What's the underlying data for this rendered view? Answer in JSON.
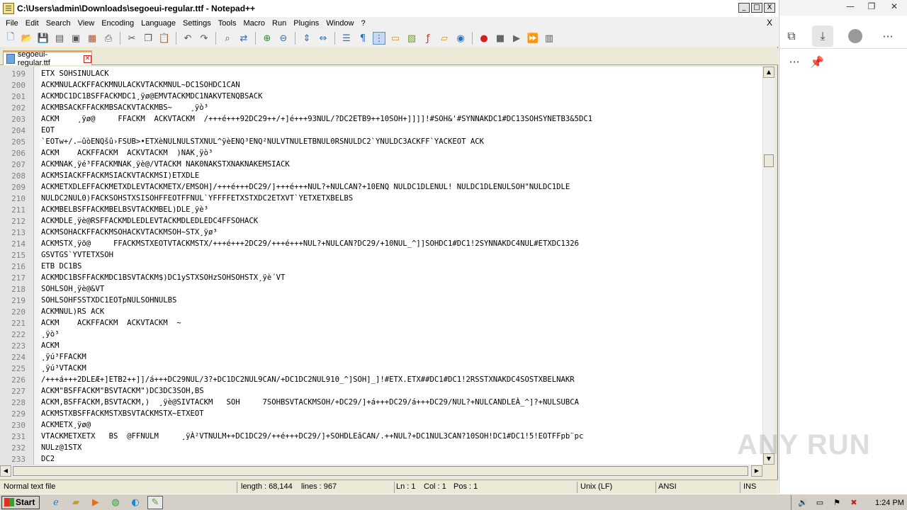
{
  "window": {
    "title": "C:\\Users\\admin\\Downloads\\segoeui-regular.ttf - Notepad++",
    "minimize": "_",
    "maximize": "□",
    "close": "X"
  },
  "menu": {
    "items": [
      "File",
      "Edit",
      "Search",
      "View",
      "Encoding",
      "Language",
      "Settings",
      "Tools",
      "Macro",
      "Run",
      "Plugins",
      "Window",
      "?"
    ],
    "close_doc": "X"
  },
  "toolbar": {
    "icons": [
      "new-file-icon",
      "open-file-icon",
      "save-icon",
      "save-all-icon",
      "close-icon",
      "close-all-icon",
      "print-icon",
      "cut-icon",
      "copy-icon",
      "paste-icon",
      "undo-icon",
      "redo-icon",
      "find-icon",
      "replace-icon",
      "zoom-in-icon",
      "zoom-out-icon",
      "sync-vertical-icon",
      "sync-horizontal-icon",
      "word-wrap-icon",
      "show-all-chars-icon",
      "indent-guide-icon",
      "udl-icon",
      "doc-map-icon",
      "function-list-icon",
      "folder-workspace-icon",
      "monitoring-icon",
      "record-macro-icon",
      "stop-macro-icon",
      "play-macro-icon",
      "run-macro-multiple-icon",
      "save-macro-icon"
    ]
  },
  "tab": {
    "label": "segoeui-regular.ttf",
    "close": "✕"
  },
  "editor": {
    "lines": [
      {
        "n": "199",
        "text": "ETX SOHSINULACK"
      },
      {
        "n": "200",
        "text": "ACKMNULACKFFACKMNULACKVTACKMNUL~DC1SOHDC1CAN"
      },
      {
        "n": "201",
        "text": "ACKMDC1DC1BSFFACKMDC1¸ÿø@EMVTACKMDC1NAKVTENQBSACK"
      },
      {
        "n": "202",
        "text": "ACKMBSACKFFACKMBSACKVTACKMBS~    ¸ÿò³"
      },
      {
        "n": "203",
        "text": "ACKM    ¸ÿø@     FFACKM  ACKVTACKM  /+++é+++92DC29++/+]é+++93NUL/?DC2ETB9++10SOH+]]]]!#SOH&'#SYNNAKDC1#DC13SOHSYNETB3&5DC1"
      },
      {
        "n": "204",
        "text": "EOT"
      },
      {
        "n": "205",
        "text": "`EOTw+/.—ûòENQšû›FSUB>•ETXèNULNULSTXNUL^ÿèENQ³ENQ²NULVTNULETBNUL0RSNULDC2`YNULDC3ACKFF`YACKEOT ACK"
      },
      {
        "n": "206",
        "text": "ACKM    ACKFFACKM  ACKVTACKM  )NAK¸ÿò³"
      },
      {
        "n": "207",
        "text": "ACKMNAK¸ÿé³FFACKMNAK¸ÿè@/VTACKM NAK0NAKSTXNAKNAKEMSIACK"
      },
      {
        "n": "208",
        "text": "ACKMSIACKFFACKMSIACKVTACKMSI)ETXDLE"
      },
      {
        "n": "209",
        "text": "ACKMETXDLEFFACKMETXDLEVTACKMETX/EMSOH]/+++é+++DC29/]+++é+++NUL?+NULCAN?+10ENQ NULDC1DLENUL! NULDC1DLENULSOH\"NULDC1DLE"
      },
      {
        "n": "210",
        "text": "NULDC2NUL0)FACKSOHSTXSISOHFFEOTFFNUL`YFFFFETXSTXDC2ETXVT`YETXETXBELBS"
      },
      {
        "n": "211",
        "text": "ACKMBELBSFFACKMBELBSVTACKMBEL)DLE¸ÿè³"
      },
      {
        "n": "212",
        "text": "ACKMDLE¸ÿè@RSFFACKMDLEDLEVTACKMDLEDLEDC4FFSOHACK"
      },
      {
        "n": "213",
        "text": "ACKMSOHACKFFACKMSOHACKVTACKMSOH~STX¸ÿø³"
      },
      {
        "n": "214",
        "text": "ACKMSTX¸ÿö@     FFACKMSTXEOTVTACKMSTX/+++é+++2DC29/+++é+++NUL?+NULCAN?DC29/+10NUL_^]]SOHDC1#DC1!2SYNNAKDC4NUL#ETXDC1326"
      },
      {
        "n": "215",
        "text": "GSVTGS`YVTETXSOH"
      },
      {
        "n": "216",
        "text": "ETB DC1BS"
      },
      {
        "n": "217",
        "text": "ACKMDC1BSFFACKMDC1BSVTACKM$)DC1ySTXSOHzSOHSOHSTX¸ÿè´VT"
      },
      {
        "n": "218",
        "text": "SOHLSOH¸ÿè@&VT"
      },
      {
        "n": "219",
        "text": "SOHLSOHFSSTXDC1EOTpNULSOHNULBS"
      },
      {
        "n": "220",
        "text": "ACKMNUL)RS ACK"
      },
      {
        "n": "221",
        "text": "ACKM    ACKFFACKM  ACKVTACKM  ~"
      },
      {
        "n": "222",
        "text": "¸ÿò³"
      },
      {
        "n": "223",
        "text": "ACKM"
      },
      {
        "n": "224",
        "text": "¸ÿú³FFACKM"
      },
      {
        "n": "225",
        "text": "¸ÿú³VTACKM"
      },
      {
        "n": "226",
        "text": "/+++á+++2DLEÆ+]ETB2++]]/á+++DC29NUL/3?+DC1DC2NUL9CAN/+DC1DC2NUL910_^]SOH]_]!#ETX.ETX##DC1#DC1!2RSSTXNAKDC4SOSTXBELNAKR"
      },
      {
        "n": "227",
        "text": "ACKM\"BSFFACKM\"BSVTACKM\")DC3DC3SOH,BS"
      },
      {
        "n": "228",
        "text": "ACKM,BSFFACKM,BSVTACKM,)  ¸ÿè@SIVTACKM   SOH     7SOHBSVTACKMSOH/+DC29/]+á+++DC29/á+++DC29/NUL?+NULCANDLEÀ_^]?+NULSUBCA"
      },
      {
        "n": "229",
        "text": "ACKMSTXBSFFACKMSTXBSVTACKMSTX~ETXEOT"
      },
      {
        "n": "230",
        "text": "ACKMETX¸ÿø@"
      },
      {
        "n": "231",
        "text": "VTACKMETXETX   BS  @FFNULM     ¸ÿÀ²VTNULM++DC1DC29/++é+++DC29/]+SOHDLEâCAN/.++NUL?+DC1NUL3CAN?10SOH!DC1#DC1!5!EOTFFpb¨pc"
      },
      {
        "n": "232",
        "text": "NULz@1STX"
      },
      {
        "n": "233",
        "text": "DC2"
      }
    ]
  },
  "status": {
    "type": "Normal text file",
    "length": "length : 68,144",
    "lines": "lines : 967",
    "ln": "Ln : 1",
    "col": "Col : 1",
    "pos": "Pos : 1",
    "eol": "Unix (LF)",
    "encoding": "ANSI",
    "mode": "INS"
  },
  "browser": {
    "minimize": "—",
    "restore": "❐",
    "close": "✕",
    "more": "···",
    "watermark": "ANY RUN"
  },
  "taskbar": {
    "start_label": "Start",
    "clock": "1:24 PM"
  }
}
